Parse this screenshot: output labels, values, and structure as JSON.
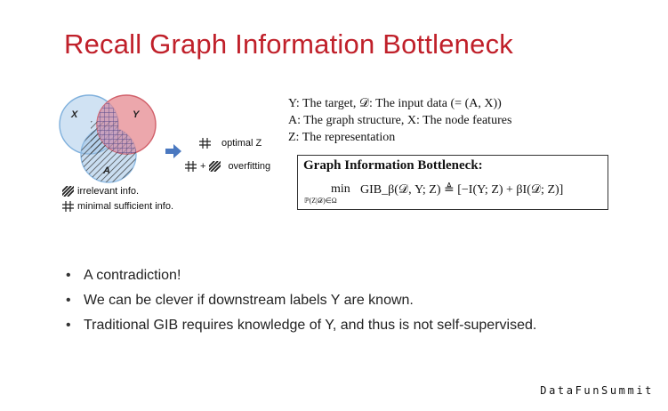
{
  "slide": {
    "title": "Recall Graph Information Bottleneck"
  },
  "venn": {
    "label_x": "X",
    "label_y": "Y",
    "label_a": "A"
  },
  "legend": {
    "irrelevant": "irrelevant info.",
    "minimal": "minimal sufficient info."
  },
  "outcomes": {
    "optimal": "optimal Z",
    "plus": "+",
    "overfitting": "overfitting"
  },
  "definitions": [
    "Y: The target, 𝒟: The input data (= (A, X))",
    "A: The graph structure, X: The node features",
    "Z: The representation"
  ],
  "gib": {
    "title": "Graph Information Bottleneck:",
    "min": "min",
    "subscript": "ℙ(Z|𝒟)∈Ω",
    "formula": "GIB_β(𝒟, Y; Z) ≜ [−I(Y; Z) + βI(𝒟; Z)]"
  },
  "bullets": [
    "A contradiction!",
    "We can be clever if downstream labels Y are known.",
    "Traditional GIB requires knowledge of Y, and thus is not self-supervised."
  ],
  "watermark": "DataFunSummit",
  "colors": {
    "title": "#c0202a",
    "circle_x": "#7fb0dc",
    "circle_y": "#e07a7f",
    "circle_a": "#8fbbe4",
    "arrow": "#4a78c0"
  }
}
